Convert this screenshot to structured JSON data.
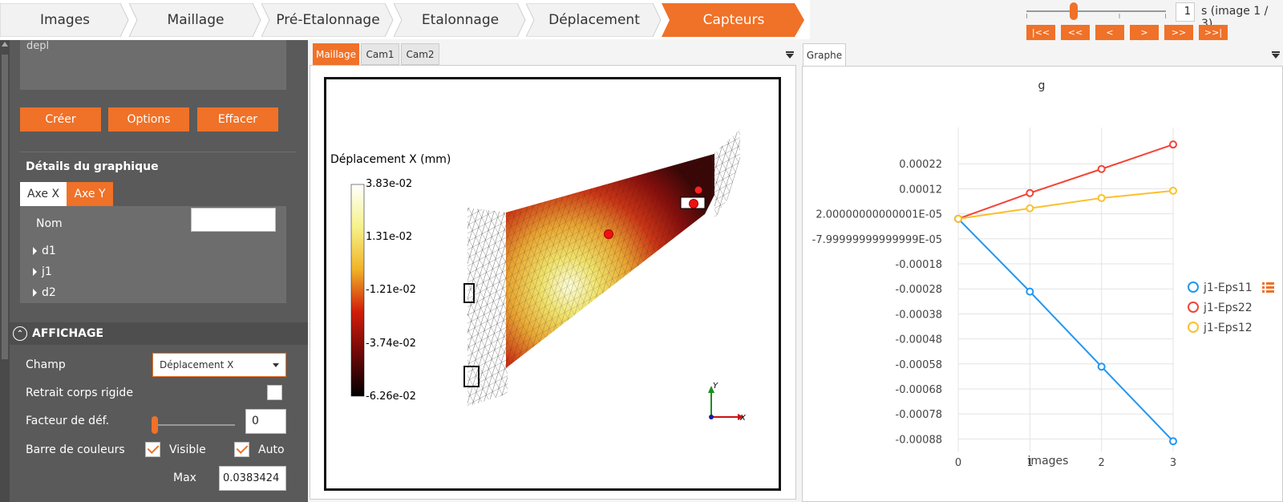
{
  "workflow": {
    "steps": [
      "Images",
      "Maillage",
      "Pré-Etalonnage",
      "Etalonnage",
      "Déplacement",
      "Capteurs"
    ],
    "active_index": 5,
    "accent": "#f07128"
  },
  "playback": {
    "frame": "1",
    "frame_label": "s (image 1 / 3)",
    "buttons": [
      "|<<",
      "<<",
      "<",
      ">",
      ">>",
      ">>|"
    ]
  },
  "left": {
    "textarea_value": "depl",
    "buttons": {
      "create": "Créer",
      "options": "Options",
      "clear": "Effacer"
    },
    "details_title": "Détails du graphique",
    "axis_tabs": [
      "Axe X",
      "Axe Y"
    ],
    "name_label": "Nom",
    "name_value": "",
    "tree_items": [
      "d1",
      "j1",
      "d2"
    ],
    "display_section": "AFFICHAGE",
    "field_label": "Champ",
    "field_value": "Déplacement X",
    "rigid_label": "Retrait corps rigide",
    "factor_label": "Facteur de déf.",
    "factor_value": "0",
    "colorbar_label": "Barre de couleurs",
    "visible_label": "Visible",
    "auto_label": "Auto",
    "max_label": "Max",
    "max_value": "0.0383424"
  },
  "viewer": {
    "tabs": [
      "Maillage",
      "Cam1",
      "Cam2"
    ],
    "colorbar_title": "Déplacement X (mm)",
    "colorbar_ticks": [
      "3.83e-02",
      "1.31e-02",
      "-1.21e-02",
      "-3.74e-02",
      "-6.26e-02"
    ],
    "axis_y": "Y",
    "axis_x": "X"
  },
  "graph": {
    "tab": "Graphe"
  },
  "chart_data": {
    "type": "line",
    "title": "g",
    "xlabel": "images",
    "ylabel": "",
    "x": [
      0,
      1,
      2,
      3
    ],
    "xlim": [
      0,
      3
    ],
    "ylim": [
      -0.00093,
      0.00032
    ],
    "ytick_values": [
      0.00022,
      0.00012,
      2e-05,
      -8e-05,
      -0.00018,
      -0.00028,
      -0.00038,
      -0.00048,
      -0.00058,
      -0.00068,
      -0.00078,
      -0.00088
    ],
    "ytick_labels": [
      "0.00022",
      "0.00012",
      "2.00000000000001E-05",
      "-7.99999999999999E-05",
      "-0.00018",
      "-0.00028",
      "-0.00038",
      "-0.00048",
      "-0.00058",
      "-0.00068",
      "-0.00078",
      "-0.00088"
    ],
    "xtick_labels": [
      "0",
      "1",
      "2",
      "3"
    ],
    "grid": true,
    "legend_position": "right",
    "series": [
      {
        "name": "j1-Eps11",
        "color": "#2196f3",
        "values": [
          0,
          -0.000291,
          -0.000591,
          -0.000889
        ]
      },
      {
        "name": "j1-Eps22",
        "color": "#f44336",
        "values": [
          0,
          0.000103,
          0.000199,
          0.000297
        ]
      },
      {
        "name": "j1-Eps12",
        "color": "#fbc02d",
        "values": [
          0,
          4.2e-05,
          8.3e-05,
          0.000112
        ]
      }
    ]
  }
}
